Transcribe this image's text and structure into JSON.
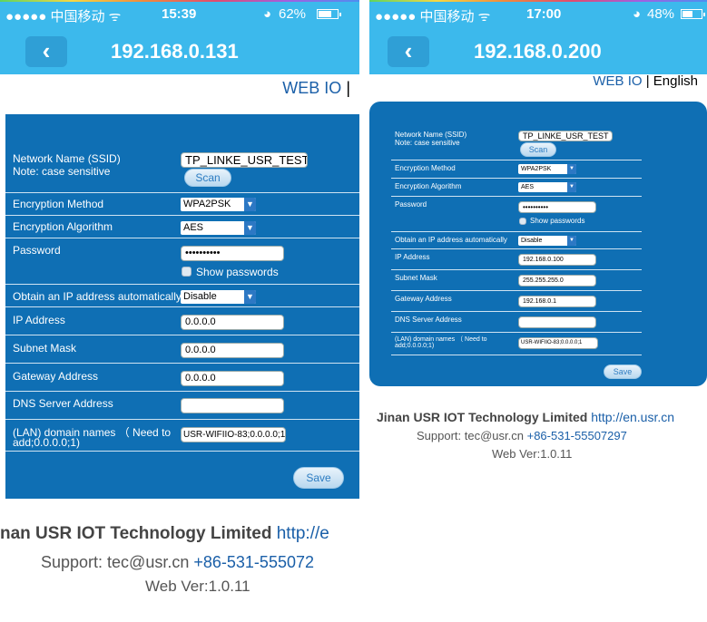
{
  "left": {
    "status": {
      "carrier": "●●●●● 中国移动 ᯤ",
      "time": "15:39",
      "battery": "62%",
      "battery_level": 0.62
    },
    "nav": {
      "back": "‹",
      "title": "192.168.0.131"
    },
    "lang": {
      "webio": "WEB IO",
      "sep": "|"
    },
    "form": {
      "ssid_label": "Network Name (SSID)",
      "ssid_note": "Note: case sensitive",
      "ssid_value": "TP_LINKE_USR_TEST",
      "scan": "Scan",
      "enc_method_label": "Encryption Method",
      "enc_method_value": "WPA2PSK",
      "enc_algo_label": "Encryption Algorithm",
      "enc_algo_value": "AES",
      "password_label": "Password",
      "password_value": "••••••••••",
      "show_passwords": "Show passwords",
      "dhcp_label": "Obtain an IP address automatically",
      "dhcp_value": "Disable",
      "ip_label": "IP Address",
      "ip_value": "0.0.0.0",
      "mask_label": "Subnet Mask",
      "mask_value": "0.0.0.0",
      "gw_label": "Gateway Address",
      "gw_value": "0.0.0.0",
      "dns_label": "DNS Server Address",
      "dns_value": "",
      "lan_label_1": "(LAN)  domain  names  （ Need  to",
      "lan_label_2": "add;0.0.0.0;1)",
      "lan_value": "USR-WIFIIO-83;0.0.0.0;1",
      "save": "Save"
    },
    "footer": {
      "company": "nan USR IOT Technology Limited",
      "url": "http://e",
      "support": "Support: tec@usr.cn",
      "phone": "+86-531-555072",
      "version": "Web Ver:1.0.11"
    }
  },
  "right": {
    "status": {
      "carrier": "●●●●● 中国移动 ᯤ",
      "time": "17:00",
      "battery": "48%",
      "battery_level": 0.48
    },
    "nav": {
      "back": "‹",
      "title": "192.168.0.200"
    },
    "lang": {
      "webio": "WEB IO",
      "sep": "|",
      "english": "English"
    },
    "form": {
      "ssid_label": "Network Name (SSID)",
      "ssid_note": "Note: case sensitive",
      "ssid_value": "TP_LINKE_USR_TEST",
      "scan": "Scan",
      "enc_method_label": "Encryption Method",
      "enc_method_value": "WPA2PSK",
      "enc_algo_label": "Encryption Algorithm",
      "enc_algo_value": "AES",
      "password_label": "Password",
      "password_value": "••••••••••",
      "show_passwords": "Show passwords",
      "dhcp_label": "Obtain an IP address automatically",
      "dhcp_value": "Disable",
      "ip_label": "IP Address",
      "ip_value": "192.168.0.100",
      "mask_label": "Subnet Mask",
      "mask_value": "255.255.255.0",
      "gw_label": "Gateway Address",
      "gw_value": "192.168.0.1",
      "dns_label": "DNS Server Address",
      "dns_value": "",
      "lan_label_1": "(LAN)  domain  names  （ Need  to",
      "lan_label_2": "add;0.0.0.0;1)",
      "lan_value": "USR-WIFIIO-83;0.0.0.0;1",
      "save": "Save"
    },
    "footer": {
      "company": "Jinan USR IOT Technology Limited",
      "url": "http://en.usr.cn",
      "support": "Support: tec@usr.cn",
      "phone": "+86-531-55507297",
      "version": "Web Ver:1.0.11"
    }
  }
}
